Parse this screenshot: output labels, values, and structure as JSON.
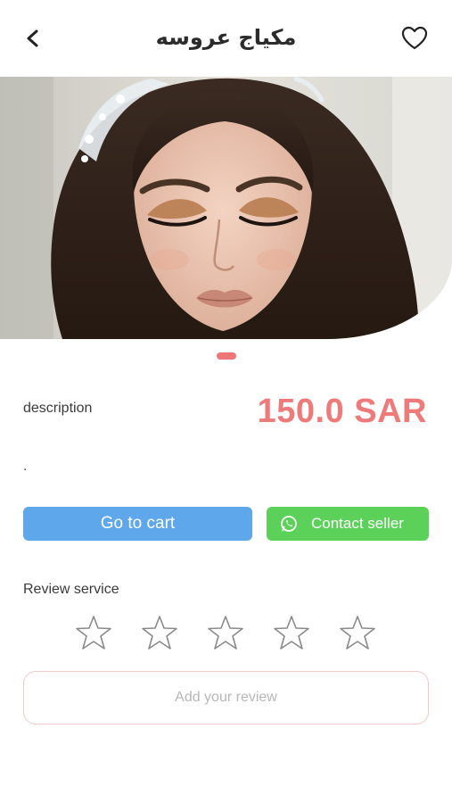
{
  "header": {
    "title": "مكياج عروسه",
    "back_icon": "chevron-left-icon",
    "favorite_icon": "heart-outline-icon"
  },
  "hero": {
    "image_subject": "bride-makeup-photo",
    "pager_active_color": "#ee7676"
  },
  "product": {
    "description_label": "description",
    "price": "150.0 SAR",
    "description_text": ".",
    "price_color": "#ee7a7a"
  },
  "actions": {
    "cart_label": "Go to cart",
    "cart_color": "#5ea7eb",
    "contact_label": "Contact seller",
    "contact_icon": "whatsapp-icon",
    "contact_color": "#5cd15a"
  },
  "review": {
    "label": "Review service",
    "rating": 0,
    "max_rating": 5,
    "add_placeholder": "Add your review"
  }
}
